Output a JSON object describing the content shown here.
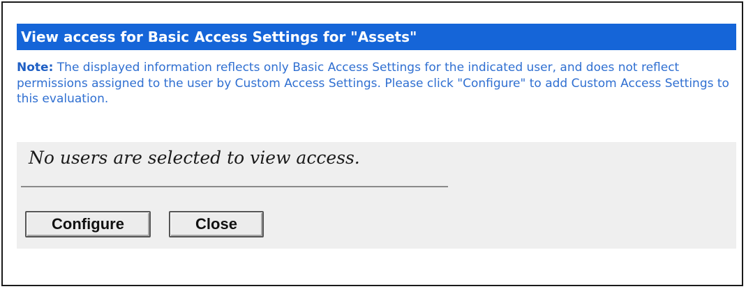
{
  "dialog": {
    "title": "View access for Basic Access Settings for \"Assets\"",
    "note_label": "Note:",
    "note_text": " The displayed information reflects only Basic Access Settings for the indicated user, and does not reflect permissions assigned to the user by Custom Access Settings. Please click \"Configure\" to add Custom Access Settings to this evaluation.",
    "empty_message": "No users are selected to view access.",
    "buttons": {
      "configure": "Configure",
      "close": "Close"
    }
  },
  "colors": {
    "title_bar": "#1565d8",
    "note_text": "#2f6fd1",
    "panel_bg": "#efefef"
  }
}
